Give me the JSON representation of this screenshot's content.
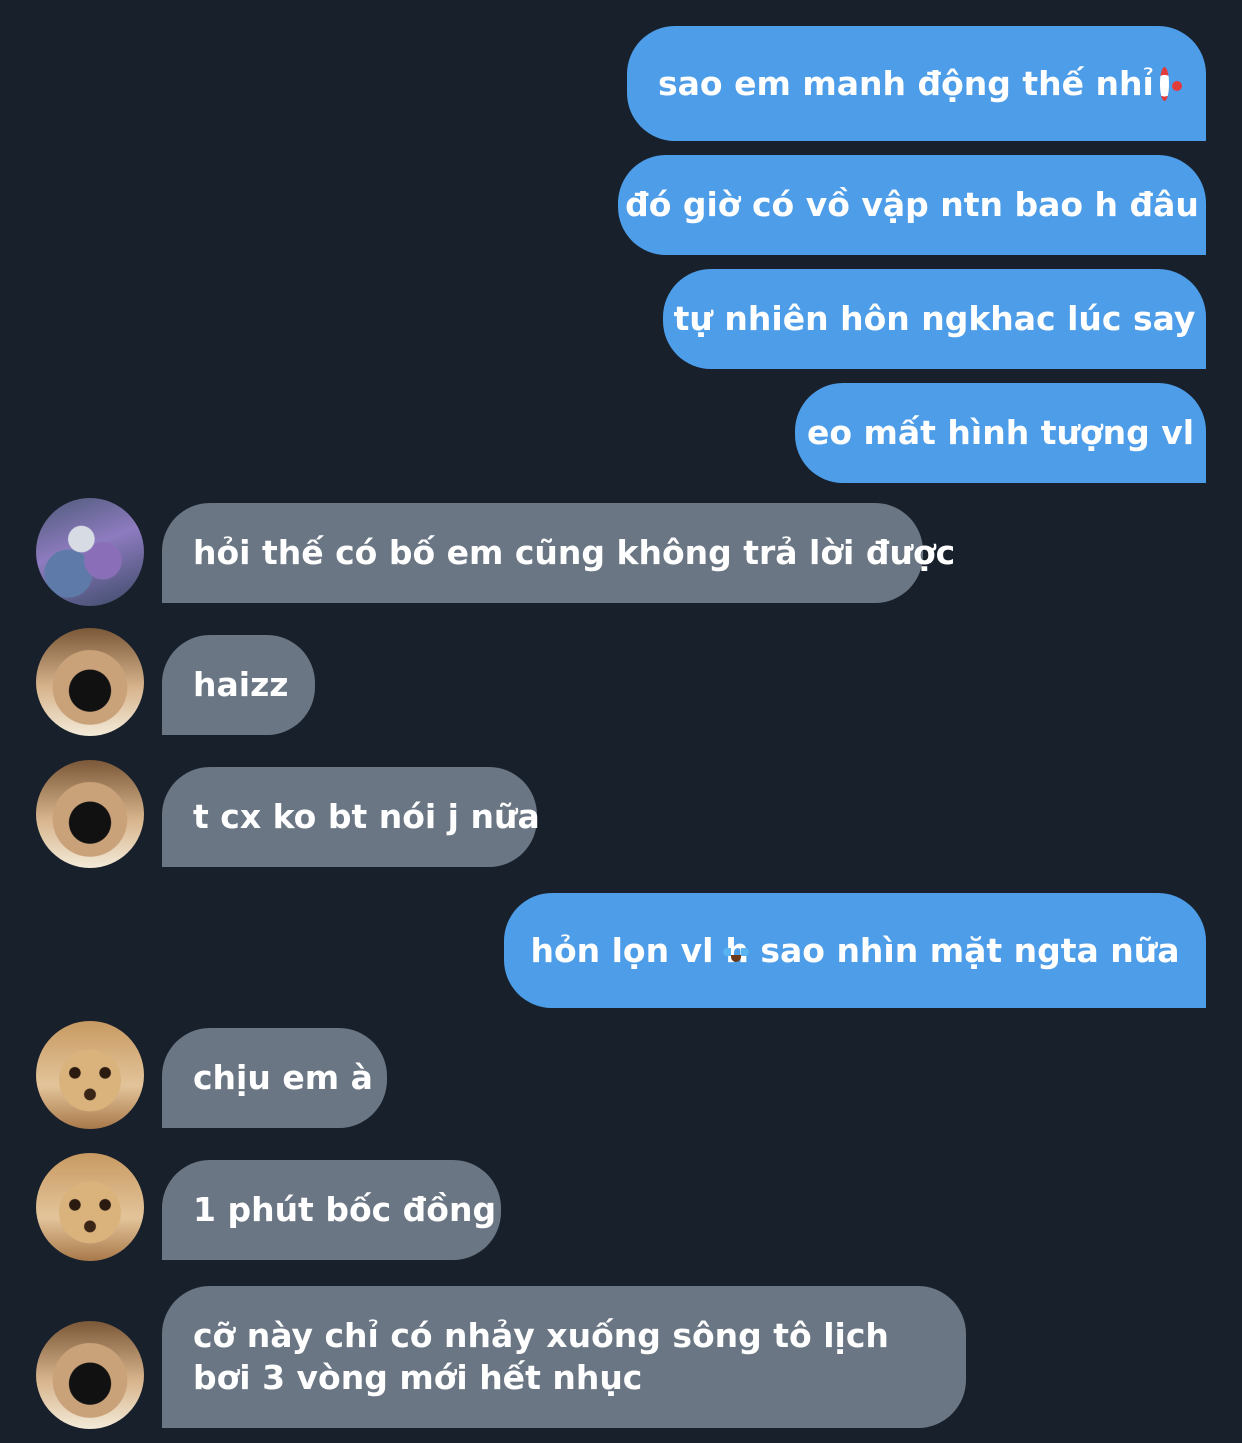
{
  "colors": {
    "background": "#18202b",
    "outgoing_bubble": "#4d9de8",
    "incoming_bubble": "#6a7684",
    "text": "#ffffff"
  },
  "messages": [
    {
      "direction": "outgoing",
      "text": "sao em manh động thế nhỉ",
      "emoji": "clown-face"
    },
    {
      "direction": "outgoing",
      "text": "đó giờ có vồ vập ntn bao h đâu"
    },
    {
      "direction": "outgoing",
      "text": "tự nhiên hôn ngkhac lúc say"
    },
    {
      "direction": "outgoing",
      "text": "eo mất hình tượng vl"
    },
    {
      "direction": "incoming",
      "avatar": "raccoon-meme-avatar",
      "text": "hỏi thế có bố em cũng không trả lời được"
    },
    {
      "direction": "incoming",
      "avatar": "dog-nose-avatar",
      "text": "haizz"
    },
    {
      "direction": "incoming",
      "avatar": "dog-nose-avatar",
      "text": "t cx ko bt nói j nữa"
    },
    {
      "direction": "outgoing",
      "text_before": "hỏn lọn vl",
      "emoji": "loudly-crying-face",
      "text_after": "h sao nhìn mặt ngta nữa"
    },
    {
      "direction": "incoming",
      "avatar": "chihuahua-avatar",
      "text": "chịu em à"
    },
    {
      "direction": "incoming",
      "avatar": "chihuahua-avatar",
      "text": "1 phút bốc đồng"
    },
    {
      "direction": "incoming",
      "avatar": "dog-nose-avatar",
      "text": "cỡ này chỉ có nhảy xuống sông tô lịch bơi 3 vòng mới hết nhục"
    }
  ]
}
